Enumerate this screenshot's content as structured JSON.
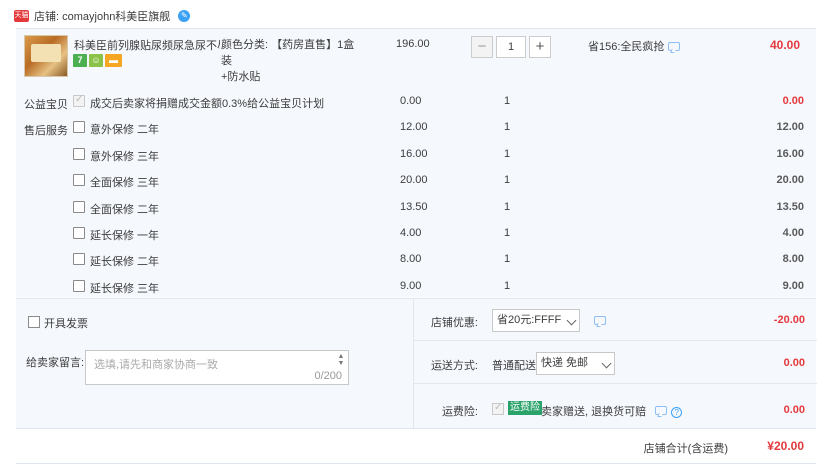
{
  "shop": {
    "logo_text": "天猫",
    "name": "店铺: comayjohn科美臣旗舰",
    "ww_icon": "wangwang-icon"
  },
  "item": {
    "title": "科美臣前列腺贴尿频尿急尿不尽...",
    "badges": [
      "7",
      "☺",
      "▬"
    ],
    "spec_line1": "颜色分类: 【药房直售】1盒装",
    "spec_line2": "+防水贴",
    "unit_price": "196.00",
    "quantity": "1",
    "minus_label": "−",
    "plus_label": "+",
    "promo": "省156:全民疯抢",
    "total": "40.00"
  },
  "charity": {
    "label": "公益宝贝",
    "text": "成交后卖家将捐赠成交金额0.3%给公益宝贝计划",
    "price": "0.00",
    "qty": "1",
    "total": "0.00"
  },
  "after_sales": {
    "label": "售后服务",
    "options": [
      {
        "name": "意外保修 二年",
        "price": "12.00",
        "qty": "1",
        "total": "12.00"
      },
      {
        "name": "意外保修 三年",
        "price": "16.00",
        "qty": "1",
        "total": "16.00"
      },
      {
        "name": "全面保修 三年",
        "price": "20.00",
        "qty": "1",
        "total": "20.00"
      },
      {
        "name": "全面保修 二年",
        "price": "13.50",
        "qty": "1",
        "total": "13.50"
      },
      {
        "name": "延长保修 一年",
        "price": "4.00",
        "qty": "1",
        "total": "4.00"
      },
      {
        "name": "延长保修 二年",
        "price": "8.00",
        "qty": "1",
        "total": "8.00"
      },
      {
        "name": "延长保修 三年",
        "price": "9.00",
        "qty": "1",
        "total": "9.00"
      }
    ]
  },
  "invoice": {
    "label": "开具发票"
  },
  "message": {
    "label": "给卖家留言:",
    "placeholder": "选填,请先和商家协商一致",
    "counter": "0/200"
  },
  "discount": {
    "label": "店铺优惠:",
    "selected": "省20元:FFFF",
    "total": "-20.00"
  },
  "shipping": {
    "label": "运送方式:",
    "type": "普通配送",
    "selected": "快递 免邮",
    "total": "0.00"
  },
  "insurance": {
    "label": "运费险:",
    "tag": "运费险",
    "text": "卖家赠送, 退换货可赔",
    "help": "?",
    "total": "0.00"
  },
  "summary": {
    "label": "店铺合计(含运费)",
    "value": "¥20.00"
  },
  "colors": {
    "accent_red": "#e4393c",
    "block_bg": "#f5f8fd",
    "link_blue": "#3ba1f5"
  }
}
